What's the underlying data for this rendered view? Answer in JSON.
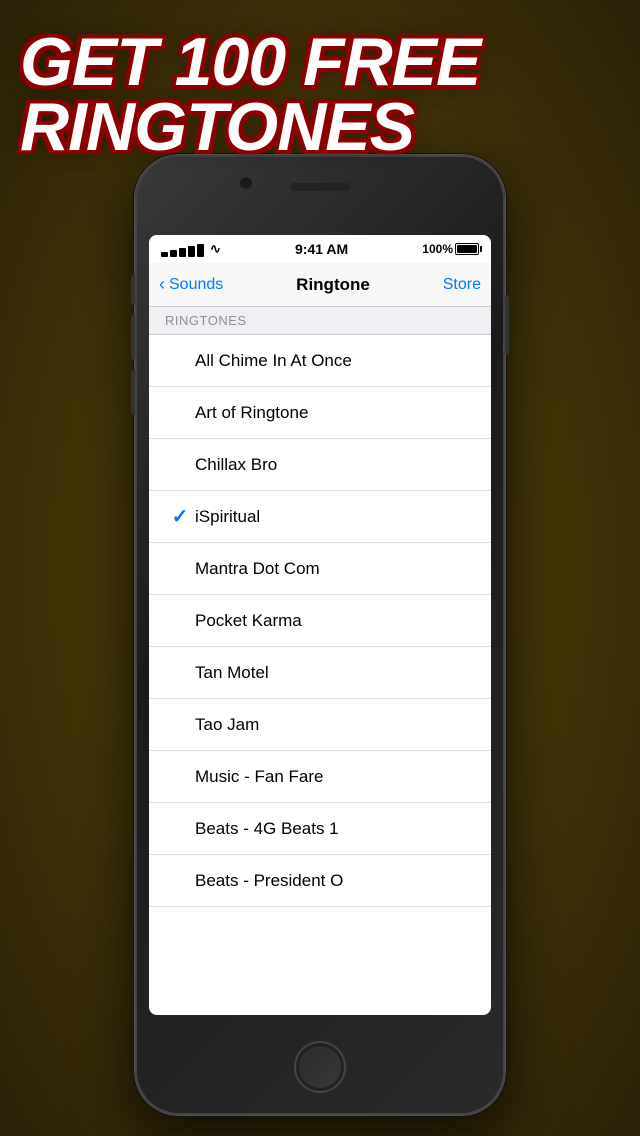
{
  "background": {
    "promo_line1": "GET 100 FREE",
    "promo_line2": "RINGTONES"
  },
  "status_bar": {
    "signal": "●●●●●",
    "time": "9:41 AM",
    "battery_pct": "100%"
  },
  "nav": {
    "back_label": "Sounds",
    "title": "Ringtone",
    "store_label": "Store"
  },
  "section": {
    "header": "RINGTONES"
  },
  "ringtones": [
    {
      "name": "All Chime In At Once",
      "selected": false
    },
    {
      "name": "Art of Ringtone",
      "selected": false
    },
    {
      "name": "Chillax Bro",
      "selected": false
    },
    {
      "name": "iSpiritual",
      "selected": true
    },
    {
      "name": "Mantra Dot Com",
      "selected": false
    },
    {
      "name": "Pocket Karma",
      "selected": false
    },
    {
      "name": "Tan Motel",
      "selected": false
    },
    {
      "name": "Tao Jam",
      "selected": false
    },
    {
      "name": "Music - Fan Fare",
      "selected": false
    },
    {
      "name": "Beats - 4G Beats 1",
      "selected": false
    },
    {
      "name": "Beats - President O",
      "selected": false
    }
  ]
}
